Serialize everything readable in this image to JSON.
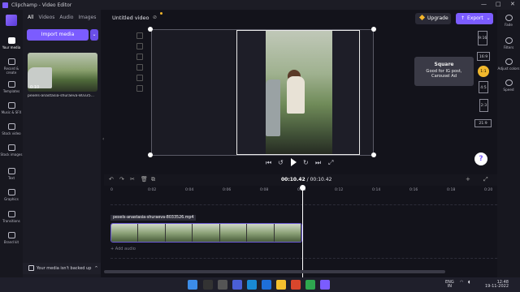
{
  "window": {
    "title": "Clipchamp - Video Editor"
  },
  "left_rail": {
    "items": [
      {
        "label": "Your media",
        "icon": "folder-icon"
      },
      {
        "label": "Record & create",
        "icon": "record-icon"
      },
      {
        "label": "Templates",
        "icon": "templates-icon"
      },
      {
        "label": "Music & SFX",
        "icon": "music-icon"
      },
      {
        "label": "Stock video",
        "icon": "stock-video-icon"
      },
      {
        "label": "Stock images",
        "icon": "stock-images-icon"
      },
      {
        "label": "Text",
        "icon": "text-icon"
      },
      {
        "label": "Graphics",
        "icon": "graphics-icon"
      },
      {
        "label": "Transitions",
        "icon": "transitions-icon"
      },
      {
        "label": "Brand kit",
        "icon": "brand-kit-icon"
      }
    ]
  },
  "media_panel": {
    "tabs": [
      "All",
      "Videos",
      "Audio",
      "Images"
    ],
    "import_label": "Import media",
    "thumb": {
      "duration": "0:10",
      "name": "pexels-anastasia-shuraeva-80335..."
    },
    "backup_text": "Your media isn't backed up"
  },
  "header": {
    "project_title": "Untitled video",
    "upgrade_label": "Upgrade",
    "export_label": "Export"
  },
  "aspect_ratios": [
    "9:16",
    "16:9",
    "1:1",
    "4:5",
    "2:3",
    "21:9"
  ],
  "tooltip": {
    "title": "Square",
    "line1": "Good for IG post,",
    "line2": "Carousel Ad"
  },
  "help_label": "?",
  "right_rail": {
    "items": [
      "Fade",
      "Filters",
      "Adjust colors",
      "Speed"
    ]
  },
  "timeline": {
    "current_time": "00:10.42",
    "total_time": "00:10.42",
    "ticks": [
      "0",
      "0:02",
      "0:04",
      "0:06",
      "0:08",
      "0:10",
      "0:12",
      "0:14",
      "0:16",
      "0:18",
      "0:20"
    ],
    "clip_label": "pexels-anastasia-shuraeva-8033526.mp4",
    "add_audio": "+ Add audio"
  },
  "taskbar": {
    "lang": "ENG",
    "region": "IN",
    "time": "12:48",
    "date": "19-11-2022"
  },
  "colors": {
    "accent": "#7b5cff",
    "gold": "#f1b82d",
    "bg": "#13131b"
  }
}
